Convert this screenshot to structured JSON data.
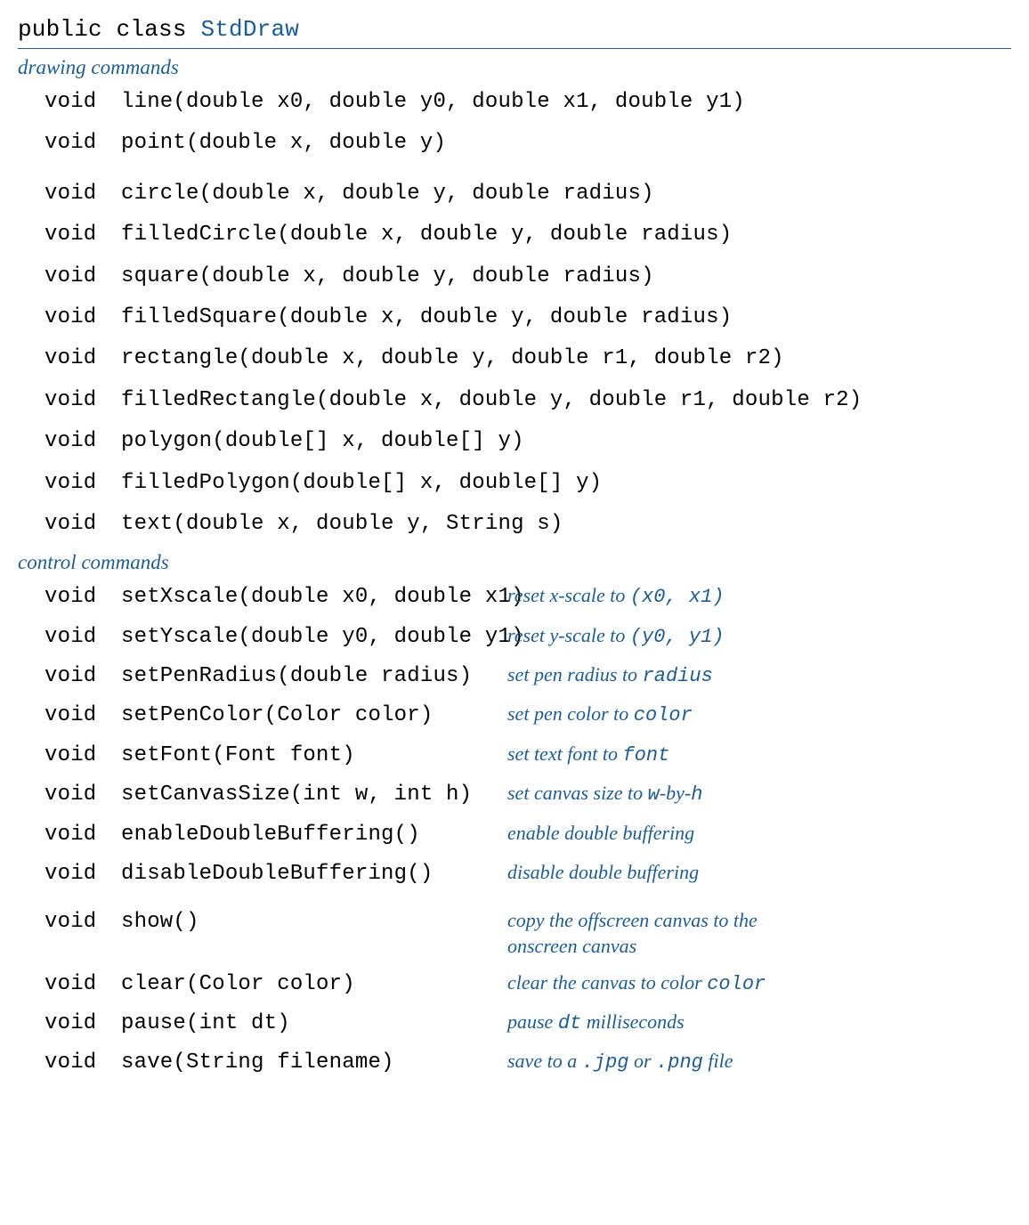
{
  "header": {
    "prefix": "public class ",
    "classname": "StdDraw"
  },
  "sections": {
    "drawing": {
      "label": "drawing commands",
      "methods": [
        {
          "ret": "void",
          "sig": "line(double x0, double y0, double x1, double y1)"
        },
        {
          "ret": "void",
          "sig": "point(double x, double y)"
        },
        {
          "ret": "void",
          "sig": "circle(double x, double y, double radius)"
        },
        {
          "ret": "void",
          "sig": "filledCircle(double x, double y, double radius)"
        },
        {
          "ret": "void",
          "sig": "square(double x, double y, double radius)"
        },
        {
          "ret": "void",
          "sig": "filledSquare(double x, double y, double radius)"
        },
        {
          "ret": "void",
          "sig": "rectangle(double x, double y, double r1, double r2)"
        },
        {
          "ret": "void",
          "sig": "filledRectangle(double x, double y, double r1, double r2)"
        },
        {
          "ret": "void",
          "sig": "polygon(double[] x, double[] y)"
        },
        {
          "ret": "void",
          "sig": "filledPolygon(double[] x, double[] y)"
        },
        {
          "ret": "void",
          "sig": "text(double x, double y, String s)"
        }
      ]
    },
    "control": {
      "label": "control commands",
      "methods": [
        {
          "ret": "void",
          "sig": "setXscale(double x0, double x1)",
          "desc_pre": "reset x-scale to ",
          "desc_code": "(x0, x1)",
          "desc_post": ""
        },
        {
          "ret": "void",
          "sig": "setYscale(double y0, double y1)",
          "desc_pre": "reset y-scale to ",
          "desc_code": "(y0, y1)",
          "desc_post": ""
        },
        {
          "ret": "void",
          "sig": "setPenRadius(double radius)",
          "desc_pre": "set pen radius to ",
          "desc_code": "radius",
          "desc_post": ""
        },
        {
          "ret": "void",
          "sig": "setPenColor(Color color)",
          "desc_pre": "set pen color to ",
          "desc_code": "color",
          "desc_post": ""
        },
        {
          "ret": "void",
          "sig": "setFont(Font font)",
          "desc_pre": "set text font to ",
          "desc_code": "font",
          "desc_post": ""
        },
        {
          "ret": "void",
          "sig": "setCanvasSize(int w, int h)",
          "desc_pre": "set canvas size to ",
          "desc_code": "w",
          "desc_mid": "-by-",
          "desc_code2": "h",
          "desc_post": ""
        },
        {
          "ret": "void",
          "sig": "enableDoubleBuffering()",
          "desc_pre": "enable double buffering",
          "desc_code": "",
          "desc_post": ""
        },
        {
          "ret": "void",
          "sig": "disableDoubleBuffering()",
          "desc_pre": "disable double buffering",
          "desc_code": "",
          "desc_post": ""
        },
        {
          "ret": "void",
          "sig": "show()",
          "desc_pre": "copy the offscreen canvas to the onscreen canvas",
          "desc_code": "",
          "desc_post": "",
          "gap_before": true
        },
        {
          "ret": "void",
          "sig": "clear(Color color)",
          "desc_pre": "clear the canvas to color ",
          "desc_code": "color",
          "desc_post": ""
        },
        {
          "ret": "void",
          "sig": "pause(int dt)",
          "desc_pre": "pause ",
          "desc_code": "dt",
          "desc_post": " milliseconds"
        },
        {
          "ret": "void",
          "sig": "save(String filename)",
          "desc_pre": "save to a ",
          "desc_code": ".jpg",
          "desc_mid": " or ",
          "desc_code2": ".png",
          "desc_post": " file"
        }
      ]
    }
  }
}
